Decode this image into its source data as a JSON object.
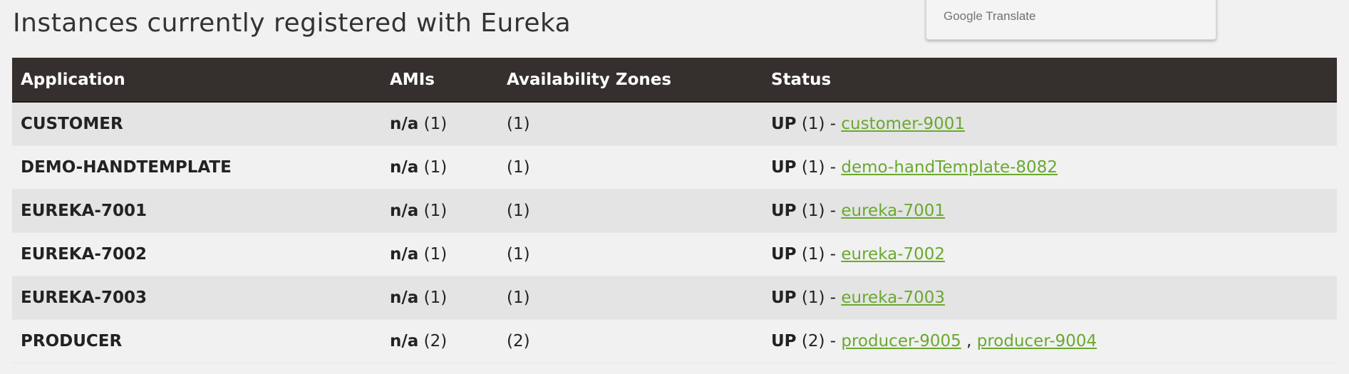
{
  "page": {
    "title": "Instances currently registered with Eureka"
  },
  "translate_popup": {
    "brand_google": "Google",
    "brand_translate": "Translate"
  },
  "table": {
    "headers": {
      "application": "Application",
      "amis": "AMIs",
      "zones": "Availability Zones",
      "status": "Status"
    },
    "rows": [
      {
        "application": "CUSTOMER",
        "ami_label": "n/a",
        "ami_count": "(1)",
        "zones": "(1)",
        "status_label": "UP",
        "status_count": "(1) -",
        "links": [
          "customer-9001"
        ]
      },
      {
        "application": "DEMO-HANDTEMPLATE",
        "ami_label": "n/a",
        "ami_count": "(1)",
        "zones": "(1)",
        "status_label": "UP",
        "status_count": "(1) -",
        "links": [
          "demo-handTemplate-8082"
        ]
      },
      {
        "application": "EUREKA-7001",
        "ami_label": "n/a",
        "ami_count": "(1)",
        "zones": "(1)",
        "status_label": "UP",
        "status_count": "(1) -",
        "links": [
          "eureka-7001"
        ]
      },
      {
        "application": "EUREKA-7002",
        "ami_label": "n/a",
        "ami_count": "(1)",
        "zones": "(1)",
        "status_label": "UP",
        "status_count": "(1) -",
        "links": [
          "eureka-7002"
        ]
      },
      {
        "application": "EUREKA-7003",
        "ami_label": "n/a",
        "ami_count": "(1)",
        "zones": "(1)",
        "status_label": "UP",
        "status_count": "(1) -",
        "links": [
          "eureka-7003"
        ]
      },
      {
        "application": "PRODUCER",
        "ami_label": "n/a",
        "ami_count": "(2)",
        "zones": "(2)",
        "status_label": "UP",
        "status_count": "(2) -",
        "links": [
          "producer-9005",
          "producer-9004"
        ],
        "link_separator": ","
      }
    ]
  },
  "colors": {
    "header_bg": "#35302d",
    "link": "#6aa82f",
    "row_odd": "#e4e4e4",
    "row_even": "#f1f1f1"
  }
}
